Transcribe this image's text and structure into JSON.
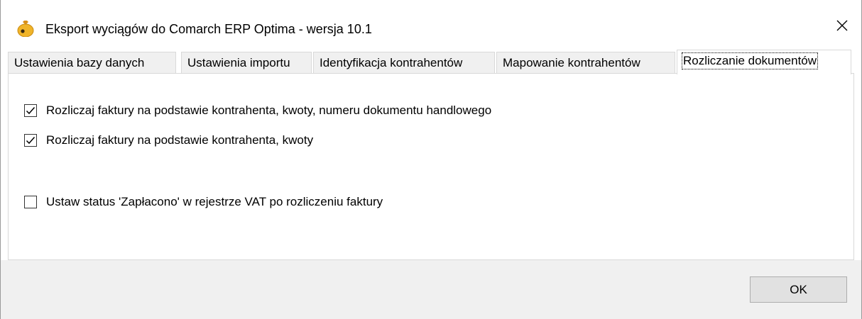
{
  "window": {
    "title": "Eksport wyciągów do Comarch ERP Optima - wersja 10.1",
    "icon": "money-bag-icon",
    "close_icon": "close-icon"
  },
  "tabs": [
    {
      "label": "Ustawienia bazy danych",
      "active": false
    },
    {
      "label": "Ustawienia importu",
      "active": false
    },
    {
      "label": "Identyfikacja kontrahentów",
      "active": false
    },
    {
      "label": "Mapowanie kontrahentów",
      "active": false
    },
    {
      "label": "Rozliczanie dokumentów",
      "active": true
    }
  ],
  "options": [
    {
      "label": "Rozliczaj faktury na podstawie kontrahenta, kwoty, numeru dokumentu handlowego",
      "checked": true
    },
    {
      "label": "Rozliczaj faktury na podstawie kontrahenta, kwoty",
      "checked": true
    },
    {
      "label": "Ustaw status 'Zapłacono' w rejestrze VAT po rozliczeniu faktury",
      "checked": false
    }
  ],
  "footer": {
    "ok_label": "OK"
  },
  "colors": {
    "icon_bag": "#f0b429",
    "tab_inactive": "#f0f0f0",
    "panel": "#f0f0f0"
  }
}
